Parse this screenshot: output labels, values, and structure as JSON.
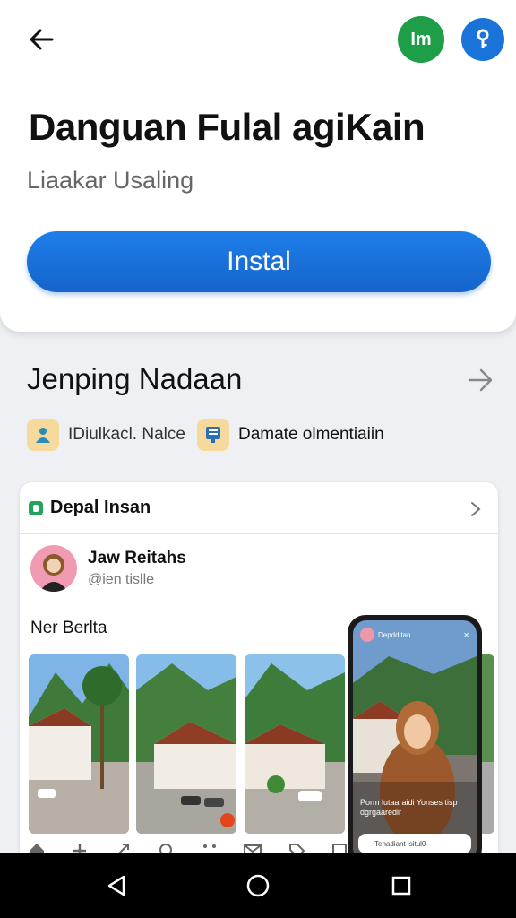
{
  "header": {
    "avatar_initials": "Im",
    "avatar_color": "#1e9e46",
    "info_color": "#1a73d9"
  },
  "app": {
    "title": "Danguan Fulal agiKain",
    "subtitle": "Liaakar Usaling",
    "install_label": "Instal",
    "accent": "#1a73d9"
  },
  "section": {
    "title": "Jenping Nadaan",
    "chips": [
      {
        "label": "IDiulkacl. Nalce",
        "icon": "person-icon"
      },
      {
        "label": "Damate olmentiaiin",
        "icon": "document-icon"
      }
    ]
  },
  "feed": {
    "header_title": "Depal Insan",
    "post": {
      "name": "Jaw Reitahs",
      "handle": "@ien tislle",
      "text": "Ner Berlta"
    },
    "phone": {
      "username": "Depdditan",
      "caption": "Porm lutaaraidi Yonses tisp dgrgaaredir",
      "input_placeholder": "Tenadiant lsitul0"
    }
  }
}
